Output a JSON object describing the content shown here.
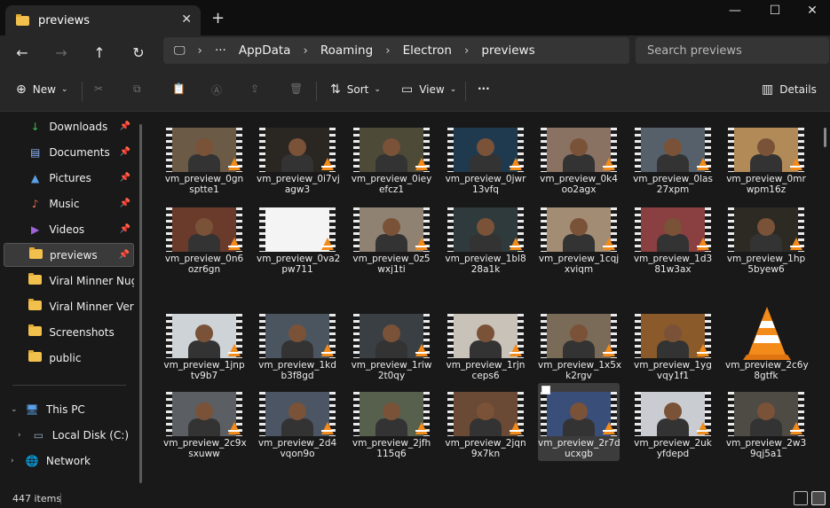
{
  "tab": {
    "title": "previews",
    "close_glyph": "✕",
    "new_tab_glyph": "+"
  },
  "window_controls": {
    "minimize": "—",
    "maximize": "☐",
    "close": "✕"
  },
  "nav": {
    "back": "←",
    "forward": "→",
    "up": "↑",
    "refresh": "↻"
  },
  "address": {
    "more": "···",
    "separator": "›",
    "crumbs": [
      "AppData",
      "Roaming",
      "Electron",
      "previews"
    ]
  },
  "search": {
    "placeholder": "Search previews"
  },
  "command_bar": {
    "new_label": "New",
    "sort_label": "Sort",
    "view_label": "View",
    "more": "···",
    "details_label": "Details"
  },
  "sidebar": {
    "items": [
      {
        "label": "Downloads",
        "icon": "download-icon",
        "pinned": true
      },
      {
        "label": "Documents",
        "icon": "documents-icon",
        "pinned": true
      },
      {
        "label": "Pictures",
        "icon": "pictures-icon",
        "pinned": true
      },
      {
        "label": "Music",
        "icon": "music-icon",
        "pinned": true
      },
      {
        "label": "Videos",
        "icon": "videos-icon",
        "pinned": true
      },
      {
        "label": "previews",
        "icon": "folder-icon",
        "pinned": true,
        "selected": true
      },
      {
        "label": "Viral Minner Nuggets",
        "icon": "folder-icon"
      },
      {
        "label": "Viral Minner Versions",
        "icon": "folder-icon"
      },
      {
        "label": "Screenshots",
        "icon": "folder-icon"
      },
      {
        "label": "public",
        "icon": "folder-icon"
      }
    ],
    "this_pc": "This PC",
    "local_disk": "Local Disk (C:)",
    "network": "Network"
  },
  "files": [
    {
      "l1": "vm_preview_0gn",
      "l2": "sptte1",
      "tint": "#6b5a45"
    },
    {
      "l1": "vm_preview_0i7vj",
      "l2": "agw3",
      "tint": "#2a2621"
    },
    {
      "l1": "vm_preview_0iey",
      "l2": "efcz1",
      "tint": "#4d4a38"
    },
    {
      "l1": "vm_preview_0jwr",
      "l2": "13vfq",
      "tint": "#1f3a4f"
    },
    {
      "l1": "vm_preview_0k4",
      "l2": "oo2agx",
      "tint": "#8a7262"
    },
    {
      "l1": "vm_preview_0las",
      "l2": "27xpm",
      "tint": "#55606b"
    },
    {
      "l1": "vm_preview_0mr",
      "l2": "wpm16z",
      "tint": "#b28a58"
    },
    {
      "l1": "vm_preview_0n6",
      "l2": "ozr6gn",
      "tint": "#6a3a2a"
    },
    {
      "l1": "vm_preview_0va2",
      "l2": "pw711",
      "tint": "#f4f4f4"
    },
    {
      "l1": "vm_preview_0z5",
      "l2": "wxj1ti",
      "tint": "#8f8272"
    },
    {
      "l1": "vm_preview_1bl8",
      "l2": "28a1k",
      "tint": "#2f3a3c"
    },
    {
      "l1": "vm_preview_1cqj",
      "l2": "xviqm",
      "tint": "#a28c74"
    },
    {
      "l1": "vm_preview_1d3",
      "l2": "81w3ax",
      "tint": "#8a4040"
    },
    {
      "l1": "vm_preview_1hp",
      "l2": "5byew6",
      "tint": "#2c2a22"
    },
    {
      "l1": "vm_preview_1jnp",
      "l2": "tv9b7",
      "tint": "#cdd3d6"
    },
    {
      "l1": "vm_preview_1kd",
      "l2": "b3f8gd",
      "tint": "#4a5560"
    },
    {
      "l1": "vm_preview_1riw",
      "l2": "2t0qy",
      "tint": "#3a3f44"
    },
    {
      "l1": "vm_preview_1rjn",
      "l2": "ceps6",
      "tint": "#c8c2b8"
    },
    {
      "l1": "vm_preview_1x5x",
      "l2": "k2rgv",
      "tint": "#7a6a58"
    },
    {
      "l1": "vm_preview_1yg",
      "l2": "vqy1f1",
      "tint": "#8a5a2a"
    },
    {
      "l1": "vm_preview_2c6y",
      "l2": "8gtfk",
      "tint": "",
      "vlc_only": true
    },
    {
      "l1": "vm_preview_2c9x",
      "l2": "sxuww",
      "tint": "#5b5e62"
    },
    {
      "l1": "vm_preview_2d4",
      "l2": "vqon9o",
      "tint": "#4b5563"
    },
    {
      "l1": "vm_preview_2jfh",
      "l2": "115q6",
      "tint": "#56604d"
    },
    {
      "l1": "vm_preview_2jqn",
      "l2": "9x7kn",
      "tint": "#6b4a35"
    },
    {
      "l1": "vm_preview_2r7d",
      "l2": "ucxgb",
      "tint": "#3a4e7a",
      "selected": true
    },
    {
      "l1": "vm_preview_2uk",
      "l2": "yfdepd",
      "tint": "#c9cdd2"
    },
    {
      "l1": "vm_preview_2w3",
      "l2": "9qj5a1",
      "tint": "#4e4a44"
    }
  ],
  "status": {
    "count": "447 items"
  },
  "colors": {
    "accent_folder": "#f2c04c",
    "vlc_orange": "#f28b1a",
    "bg": "#191919"
  }
}
